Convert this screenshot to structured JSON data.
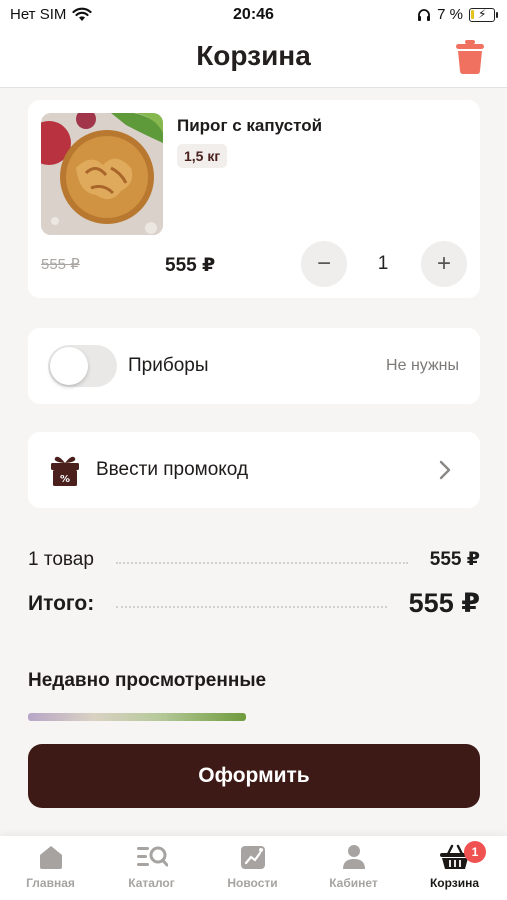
{
  "status_bar": {
    "carrier": "Нет SIM",
    "time": "20:46",
    "battery": "7 %"
  },
  "header": {
    "title": "Корзина"
  },
  "cart_item": {
    "name": "Пирог с капустой",
    "weight": "1,5 кг",
    "old_price": "555 ₽",
    "price": "555 ₽",
    "quantity": "1",
    "minus": "−",
    "plus": "+"
  },
  "cutlery": {
    "label": "Приборы",
    "value": "Не нужны",
    "enabled": false
  },
  "promo": {
    "label": "Ввести промокод"
  },
  "summary": {
    "items_label": "1 товар",
    "items_value": "555 ₽",
    "total_label": "Итого:",
    "total_value": "555 ₽"
  },
  "recent": {
    "title": "Недавно просмотренные"
  },
  "checkout": {
    "label": "Оформить"
  },
  "tabs": [
    {
      "label": "Главная",
      "icon": "home-icon",
      "active": false
    },
    {
      "label": "Каталог",
      "icon": "catalog-icon",
      "active": false
    },
    {
      "label": "Новости",
      "icon": "news-icon",
      "active": false
    },
    {
      "label": "Кабинет",
      "icon": "profile-icon",
      "active": false
    },
    {
      "label": "Корзина",
      "icon": "basket-icon",
      "active": true,
      "badge": "1"
    }
  ],
  "colors": {
    "brand_dark": "#3e1a17",
    "trash": "#f0715f",
    "badge": "#f05252"
  }
}
